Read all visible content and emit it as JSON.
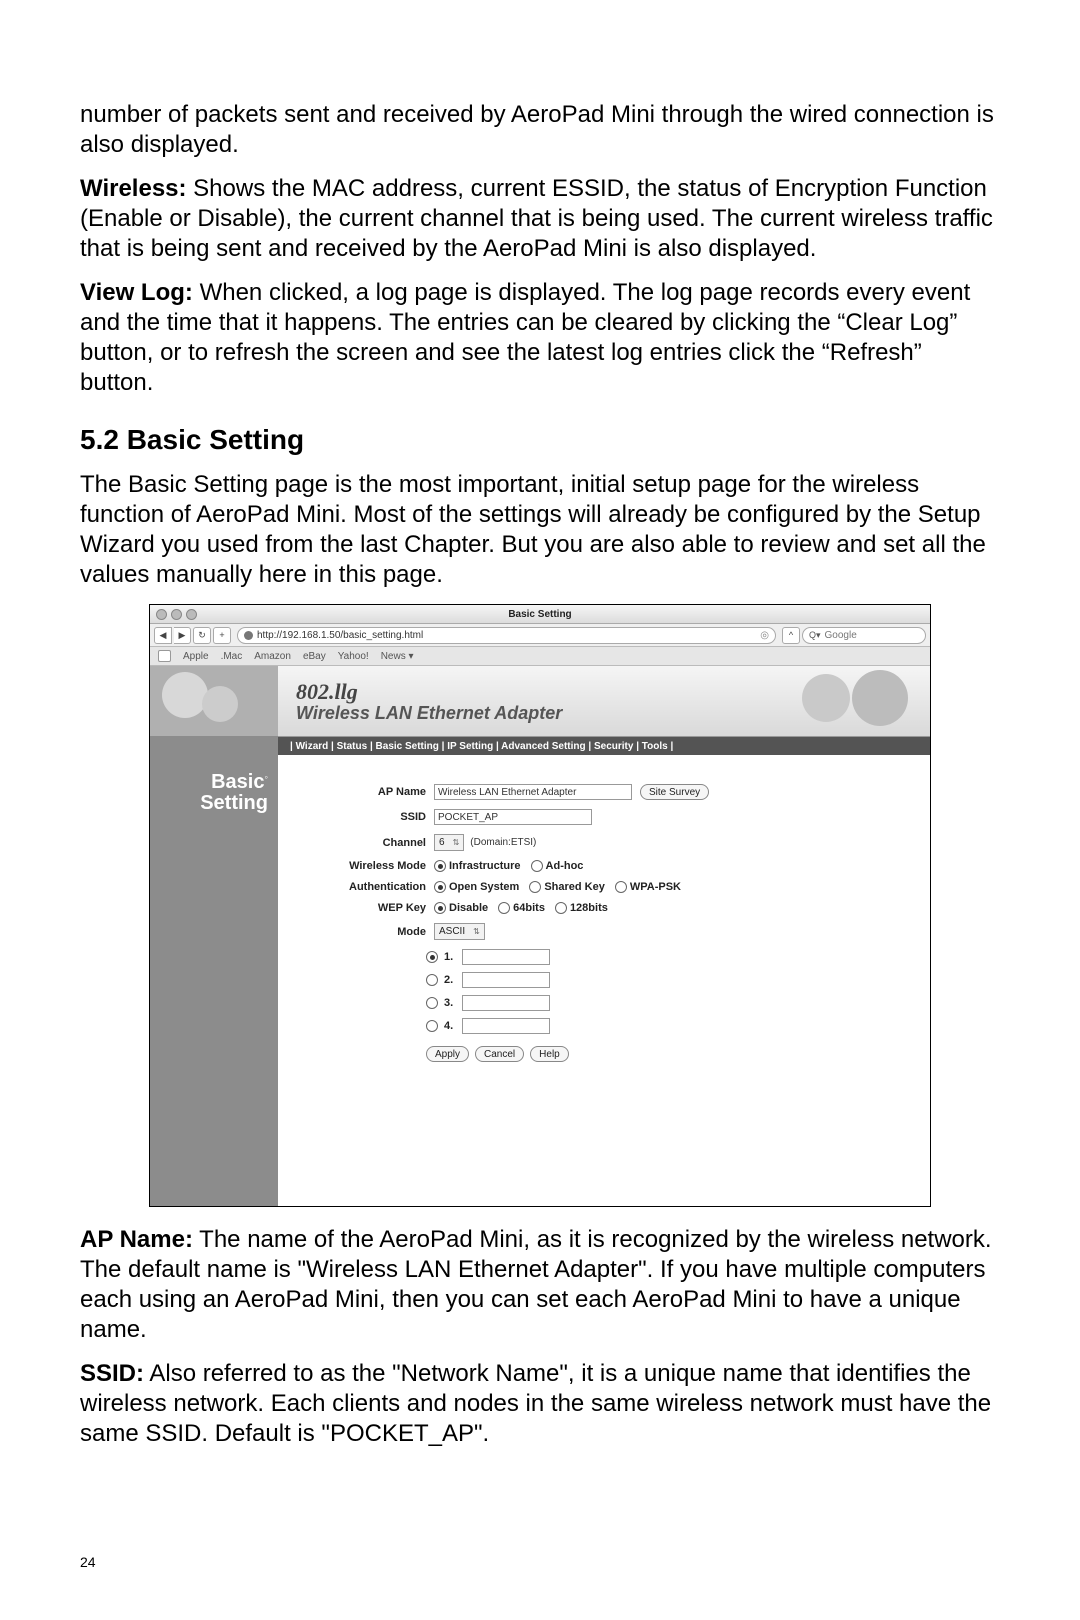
{
  "paragraphs": {
    "p1": "number of packets sent and received by AeroPad Mini through the wired connection is also displayed.",
    "p2_bold": "Wireless:",
    "p2": " Shows the MAC address, current ESSID, the status of Encryption Function (Enable or Disable), the current channel that is being used. The current wireless traffic that is being sent and received by the AeroPad Mini is also displayed.",
    "p3_bold": "View Log:",
    "p3": " When clicked, a log page is displayed.  The log page records every event and the time that it happens. The entries can be cleared by clicking the “Clear Log” button, or to refresh the screen and see the latest log entries click the “Refresh” button.",
    "heading": "5.2 Basic Setting",
    "p4": "The Basic Setting page is the most important, initial setup page for the wireless function of AeroPad Mini. Most of the settings will already be configured by the Setup Wizard you used from the last Chapter. But you are also able to review and set all the values manually here in this page.",
    "p5_bold": "AP Name:",
    "p5": " The name of the AeroPad Mini, as it is recognized by the wireless network. The default name is \"Wireless LAN Ethernet Adapter\". If you have multiple computers each using an AeroPad Mini, then you can set each AeroPad Mini to have a unique name.",
    "p6_bold": "SSID:",
    "p6": " Also referred to as the \"Network Name\", it is a unique name that identifies the wireless network. Each clients and nodes in the same wireless network must have the same SSID. Default is \"POCKET_AP\"."
  },
  "page_number": "24",
  "browser": {
    "window_title": "Basic Setting",
    "url": "http://192.168.1.50/basic_setting.html",
    "search_placeholder": "Google",
    "search_prefix": "Q▾",
    "bookmarks": [
      "Apple",
      ".Mac",
      "Amazon",
      "eBay",
      "Yahoo!",
      "News ▾"
    ],
    "back": "◀",
    "fwd": "▶",
    "reload": "↻",
    "add": "+"
  },
  "hero": {
    "brand": "802.llg",
    "sub": "Wireless LAN Ethernet Adapter",
    "nav": "| Wizard | Status |  Basic Setting  | IP Setting |  Advanced Setting  | Security | Tools |"
  },
  "sidebar_title_1": "Basic",
  "sidebar_title_2": "Setting",
  "form": {
    "ap_name_label": "AP Name",
    "ap_name_value": "Wireless LAN Ethernet Adapter",
    "site_survey": "Site Survey",
    "ssid_label": "SSID",
    "ssid_value": "POCKET_AP",
    "channel_label": "Channel",
    "channel_value": "6",
    "channel_hint": "(Domain:ETSI)",
    "wmode_label": "Wireless Mode",
    "wmode_opts": [
      "Infrastructure",
      "Ad-hoc"
    ],
    "auth_label": "Authentication",
    "auth_opts": [
      "Open System",
      "Shared Key",
      "WPA-PSK"
    ],
    "wep_label": "WEP Key",
    "wep_opts": [
      "Disable",
      "64bits",
      "128bits"
    ],
    "mode_label": "Mode",
    "mode_value": "ASCII",
    "keys": [
      "1.",
      "2.",
      "3.",
      "4."
    ],
    "apply": "Apply",
    "cancel": "Cancel",
    "help": "Help"
  }
}
